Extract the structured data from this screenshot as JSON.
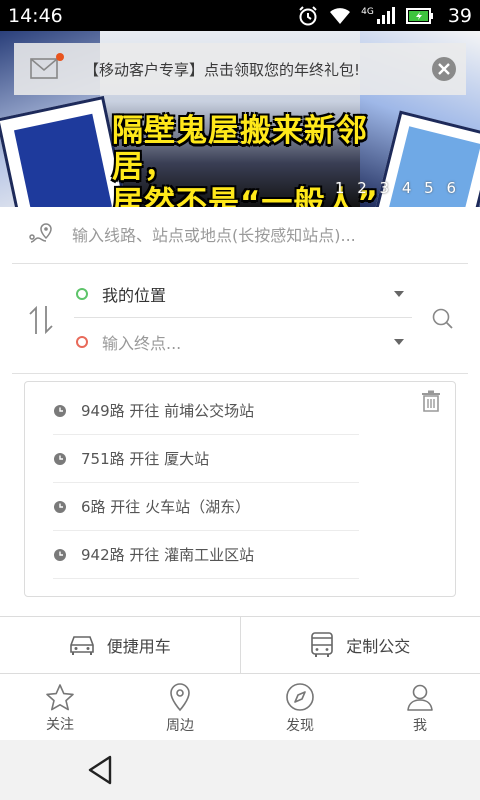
{
  "status_bar": {
    "time": "14:46",
    "network": "4G",
    "battery": "39"
  },
  "banner": {
    "title_line1": "隔壁鬼屋搬来新邻居，",
    "title_line2": "居然不是“一般人”",
    "pager": "1 2 3 4 5 6"
  },
  "notice": {
    "text": "【移动客户专享】点击领取您的年终礼包!"
  },
  "search": {
    "placeholder": "输入线路、站点或地点(长按感知站点)..."
  },
  "route": {
    "from_label": "我的位置",
    "to_placeholder": "输入终点..."
  },
  "history": {
    "items": [
      {
        "text": "949路 开往 前埔公交场站"
      },
      {
        "text": "751路 开往 厦大站"
      },
      {
        "text": "6路 开往 火车站（湖东）"
      },
      {
        "text": "942路 开往 灌南工业区站"
      }
    ]
  },
  "shortcuts": {
    "car_label": "便捷用车",
    "bus_label": "定制公交"
  },
  "tabs": [
    {
      "label": "关注",
      "icon": "star-icon"
    },
    {
      "label": "周边",
      "icon": "location-pin-icon"
    },
    {
      "label": "发现",
      "icon": "compass-icon"
    },
    {
      "label": "我",
      "icon": "person-icon"
    }
  ],
  "colors": {
    "origin": "#5ec46a",
    "destination": "#e86a5a",
    "notice_dot": "#e8541e",
    "banner_text": "#ffe81a"
  }
}
